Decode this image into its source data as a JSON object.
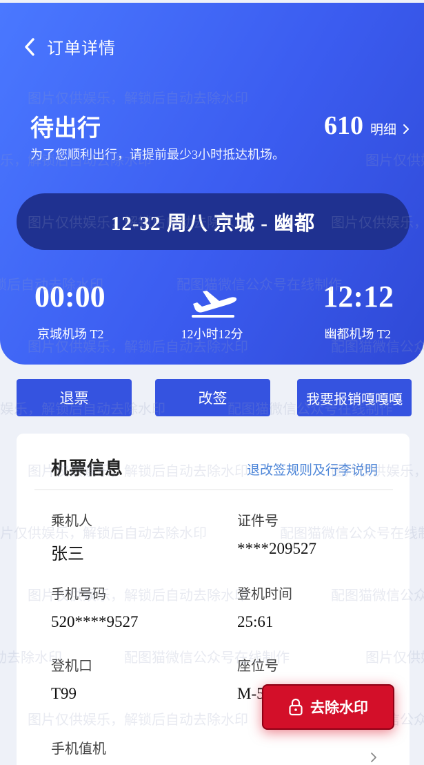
{
  "header": {
    "back_label": "订单详情",
    "status": "待出行",
    "notice": "为了您顺利出行，请提前最少3小时抵达机场。",
    "price": "610",
    "detail_label": "明细",
    "route": "12-32 周八 京城 - 幽都",
    "depart_time": "00:00",
    "arrive_time": "12:12",
    "depart_airport": "京城机场 T2",
    "arrive_airport": "幽都机场 T2",
    "duration": "12小时12分"
  },
  "actions": {
    "refund": "退票",
    "change": "改签",
    "reimburse": "我要报销嘎嘎嘎"
  },
  "ticket": {
    "title": "机票信息",
    "rules_link": "退改签规则及行李说明",
    "fields": {
      "passenger_label": "乘机人",
      "passenger_value": "张三",
      "id_label": "证件号",
      "id_value": "****209527",
      "phone_label": "手机号码",
      "phone_value": "520****9527",
      "boarding_time_label": "登机时间",
      "boarding_time_value": "25:61",
      "gate_label": "登机口",
      "gate_value": "T99",
      "seat_label": "座位号",
      "seat_value": "M-5",
      "checkin_label": "手机值机"
    }
  },
  "watermark": {
    "text_a": "图片仅供娱乐，解锁后自动去除水印",
    "text_b": "配图猫微信公众号在线制作",
    "remove_label": "去除水印"
  },
  "colors": {
    "primary": "#3553e0",
    "route_pill": "#1f3190",
    "link": "#4e86d8",
    "remove_button": "#d30f29"
  }
}
